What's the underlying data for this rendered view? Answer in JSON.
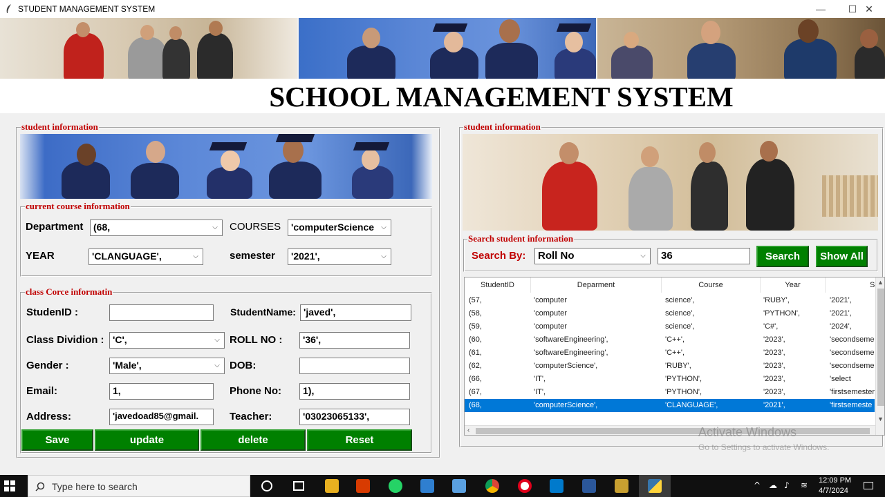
{
  "window": {
    "title": "STUDENT MANAGEMENT SYSTEM",
    "minimize": "—",
    "maximize": "☐",
    "close": "✕"
  },
  "headline": "SCHOOL MANAGEMENT SYSTEM",
  "left": {
    "frame_title": "student information",
    "course": {
      "frame_title": "current course information",
      "department_label": "Department",
      "department_value": "(68,",
      "courses_label": "COURSES",
      "courses_value": "'computerScience",
      "year_label": "YEAR",
      "year_value": "'CLANGUAGE',",
      "semester_label": "semester",
      "semester_value": "'2021',"
    },
    "class": {
      "frame_title": "class Corce informatin",
      "studentid_label": "StudenID :",
      "studentid_value": "",
      "studentname_label": "StudentName:",
      "studentname_value": "'javed',",
      "division_label": "Class Dividion :",
      "division_value": "'C',",
      "rollno_label": "ROLL NO :",
      "rollno_value": "'36',",
      "gender_label": "Gender :",
      "gender_value": "'Male',",
      "dob_label": "DOB:",
      "dob_value": "",
      "email_label": "Email:",
      "email_value": "1,",
      "phone_label": "Phone No:",
      "phone_value": "1),",
      "address_label": "Address:",
      "address_value": "'javedoad85@gmail.",
      "teacher_label": "Teacher:",
      "teacher_value": "'03023065133',"
    },
    "buttons": {
      "save": "Save",
      "update": "update",
      "delete": "delete",
      "reset": "Reset"
    }
  },
  "right": {
    "frame_title": "student information",
    "search": {
      "frame_title": "Search student information",
      "search_by_label": "Search By:",
      "search_by_value": "Roll No",
      "query_value": "36",
      "search_button": "Search",
      "show_all_button": "Show All"
    },
    "table": {
      "columns": [
        "StudentID",
        "Deparment",
        "Course",
        "Year",
        "Sem"
      ],
      "rows": [
        [
          "(57,",
          "'computer",
          "science',",
          "'RUBY',",
          "'2021',"
        ],
        [
          "(58,",
          "'computer",
          "science',",
          "'PYTHON',",
          "'2021',"
        ],
        [
          "(59,",
          "'computer",
          "science',",
          "'C#',",
          "'2024',"
        ],
        [
          "(60,",
          "'softwareEngineering',",
          "'C++',",
          "'2023',",
          "'secondseme"
        ],
        [
          "(61,",
          "'softwareEngineering',",
          "'C++',",
          "'2023',",
          "'secondseme"
        ],
        [
          "(62,",
          "'computerScience',",
          "'RUBY',",
          "'2023',",
          "'secondseme"
        ],
        [
          "(66,",
          "'IT',",
          "'PYTHON',",
          "'2023',",
          "'select"
        ],
        [
          "(67,",
          "'IT',",
          "'PYTHON',",
          "'2023',",
          "'firstsemester"
        ],
        [
          "(68,",
          "'computerScience',",
          "'CLANGUAGE',",
          "'2021',",
          "'firstsemeste"
        ]
      ],
      "selected_row": 8
    }
  },
  "watermark": {
    "line1": "Activate Windows",
    "line2": "Go to Settings to activate Windows."
  },
  "taskbar": {
    "search_placeholder": "Type here to search",
    "time": "12:09 PM",
    "date": "4/7/2024",
    "icons": [
      "start-icon",
      "search-icon",
      "cortana-icon",
      "task-view-icon",
      "file-explorer-icon",
      "office-icon",
      "whatsapp-icon",
      "folder-icon",
      "monitor-icon",
      "chrome-icon",
      "opera-icon",
      "vscode-icon",
      "word-icon",
      "app-icon",
      "python-icon"
    ]
  },
  "colors": {
    "accent_green": "#008000",
    "legend_red": "#c00000",
    "selection_blue": "#0078d7"
  }
}
